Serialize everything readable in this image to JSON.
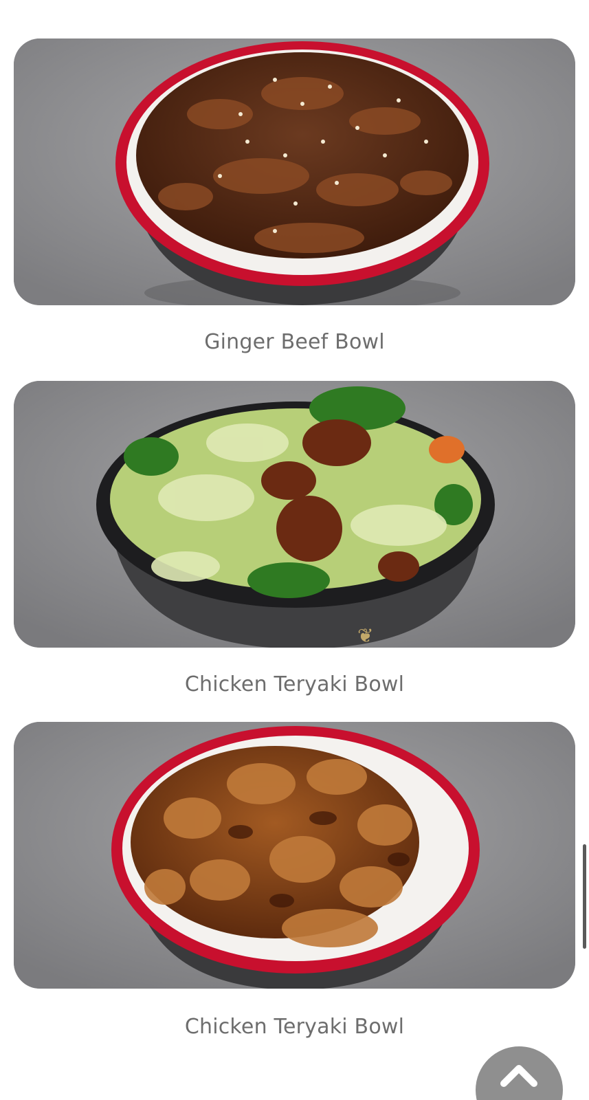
{
  "items": [
    {
      "caption": "Ginger Beef Bowl",
      "image_icon": "ginger-beef-bowl-photo"
    },
    {
      "caption": "Chicken Teryaki Bowl",
      "image_icon": "chicken-teriyaki-veggie-bowl-photo"
    },
    {
      "caption": "Chicken Teryaki Bowl",
      "image_icon": "chicken-teriyaki-bowl-photo"
    }
  ],
  "back_to_top": {
    "icon": "chevron-up-icon"
  },
  "colors": {
    "caption_text": "#6d6d6d",
    "bowl_red": "#c8102e",
    "bowl_black": "#1d1d1f",
    "button_bg": "#8f8f8f"
  }
}
